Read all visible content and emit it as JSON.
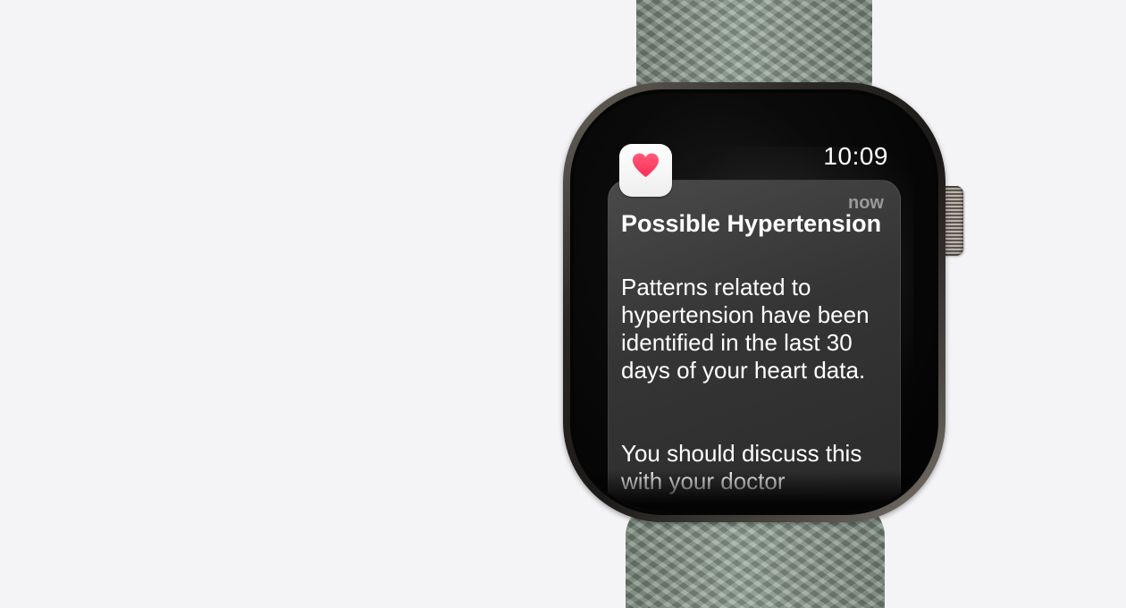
{
  "status_bar": {
    "time": "10:09"
  },
  "notification": {
    "app_icon": "heart-icon",
    "time_ago": "now",
    "title": "Possible Hypertension",
    "body_paragraph_1": "Patterns related to hypertension have been identified in the last 30 days of your heart data.",
    "body_paragraph_2": "You should discuss this with your doctor"
  },
  "colors": {
    "background": "#f4f4f7",
    "band": "#8fa193",
    "heart": "#ff2d55"
  }
}
